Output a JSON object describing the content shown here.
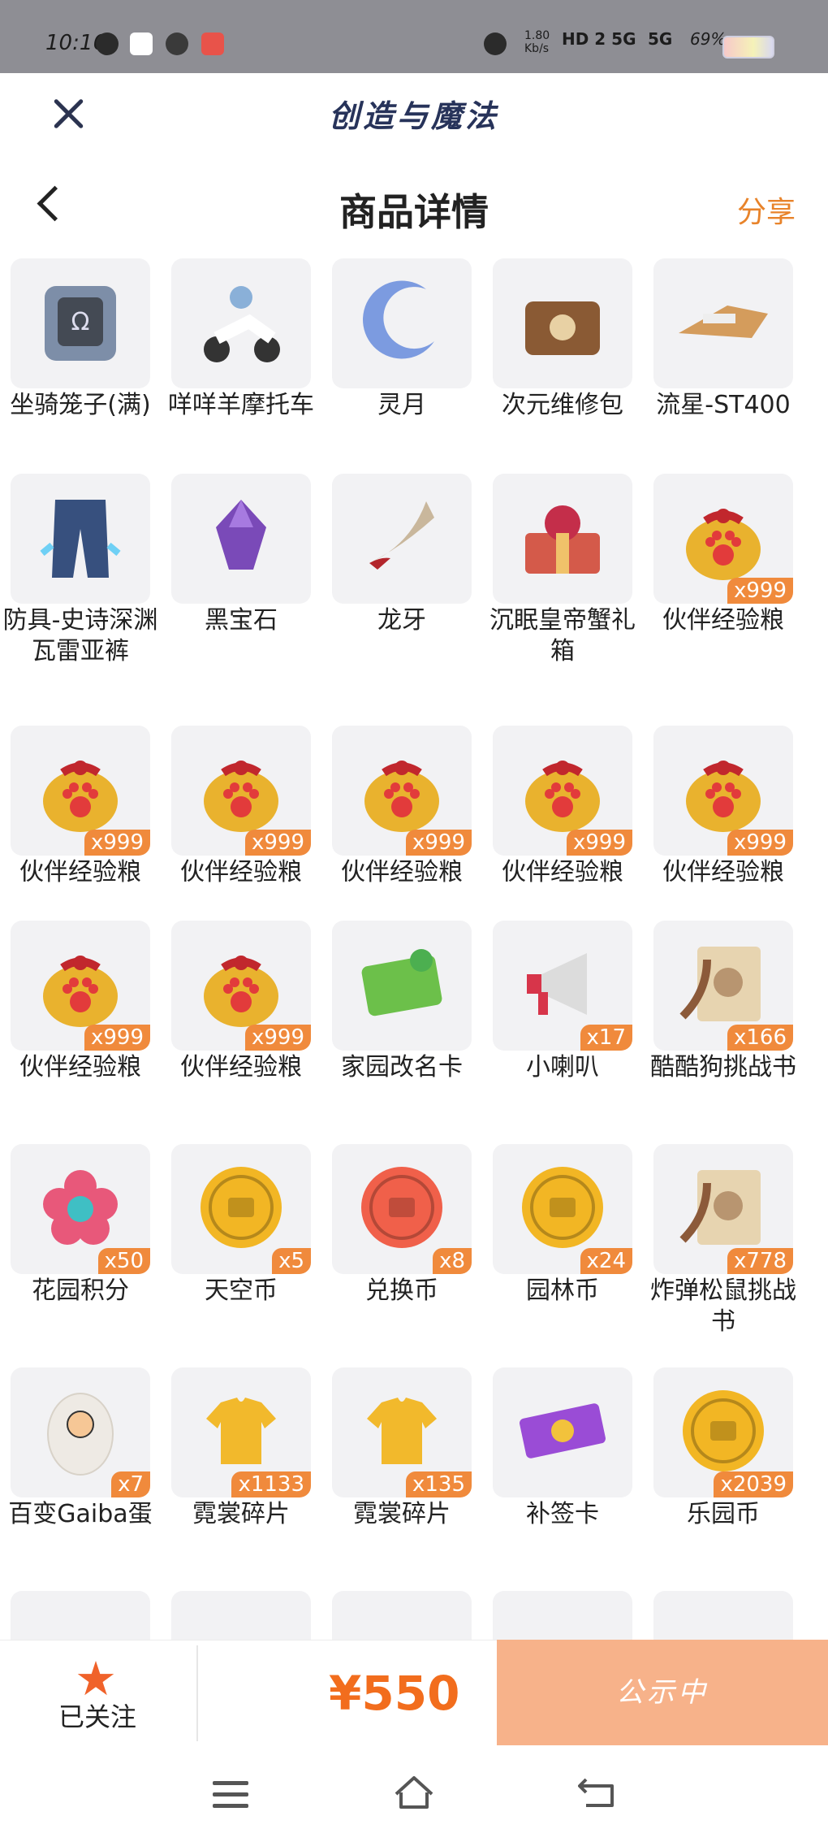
{
  "status_bar": {
    "time": "10:16",
    "network_speed": "1.80\nKb/s",
    "signal1": "HD 2 5G",
    "signal2": "5G",
    "battery": "69%"
  },
  "app_header": {
    "title": "创造与魔法"
  },
  "nav": {
    "title": "商品详情",
    "share_label": "分享"
  },
  "items": [
    {
      "label": "坐骑笼子(满)",
      "qty": "",
      "icon": "cage-icon",
      "color": "#7d8ea8"
    },
    {
      "label": "咩咩羊摩托车",
      "qty": "",
      "icon": "scooter-icon",
      "color": "#8ab0d8"
    },
    {
      "label": "灵月",
      "qty": "",
      "icon": "crescent-moon-icon",
      "color": "#7c9be0"
    },
    {
      "label": "次元维修包",
      "qty": "",
      "icon": "repair-bag-icon",
      "color": "#8a5a34"
    },
    {
      "label": "流星-ST400",
      "qty": "",
      "icon": "hoverbike-icon",
      "color": "#d49c5c"
    },
    {
      "label": "防具-史诗深渊瓦雷亚裤",
      "qty": "",
      "icon": "armor-pants-icon",
      "color": "#37507e"
    },
    {
      "label": "黑宝石",
      "qty": "",
      "icon": "black-gem-icon",
      "color": "#7a4ab8"
    },
    {
      "label": "龙牙",
      "qty": "",
      "icon": "dragon-tooth-icon",
      "color": "#c9b79c"
    },
    {
      "label": "沉眠皇帝蟹礼箱",
      "qty": "",
      "icon": "gift-chest-icon",
      "color": "#d45a4a"
    },
    {
      "label": "伙伴经验粮",
      "qty": "x999",
      "icon": "food-bag-icon",
      "color": "#e9b22e"
    },
    {
      "label": "伙伴经验粮",
      "qty": "x999",
      "icon": "food-bag-icon",
      "color": "#e9b22e"
    },
    {
      "label": "伙伴经验粮",
      "qty": "x999",
      "icon": "food-bag-icon",
      "color": "#e9b22e"
    },
    {
      "label": "伙伴经验粮",
      "qty": "x999",
      "icon": "food-bag-icon",
      "color": "#e9b22e"
    },
    {
      "label": "伙伴经验粮",
      "qty": "x999",
      "icon": "food-bag-icon",
      "color": "#e9b22e"
    },
    {
      "label": "伙伴经验粮",
      "qty": "x999",
      "icon": "food-bag-icon",
      "color": "#e9b22e"
    },
    {
      "label": "伙伴经验粮",
      "qty": "x999",
      "icon": "food-bag-icon",
      "color": "#e9b22e"
    },
    {
      "label": "伙伴经验粮",
      "qty": "x999",
      "icon": "food-bag-icon",
      "color": "#e9b22e"
    },
    {
      "label": "家园改名卡",
      "qty": "",
      "icon": "rename-card-icon",
      "color": "#6cc04a"
    },
    {
      "label": "小喇叭",
      "qty": "x17",
      "icon": "megaphone-icon",
      "color": "#d7354a"
    },
    {
      "label": "酷酷狗挑战书",
      "qty": "x166",
      "icon": "wanted-scroll-icon",
      "color": "#b89570"
    },
    {
      "label": "花园积分",
      "qty": "x50",
      "icon": "flower-token-icon",
      "color": "#e8587a"
    },
    {
      "label": "天空币",
      "qty": "x5",
      "icon": "sky-coin-icon",
      "color": "#f2b624"
    },
    {
      "label": "兑换币",
      "qty": "x8",
      "icon": "exchange-coin-icon",
      "color": "#f0604a"
    },
    {
      "label": "园林币",
      "qty": "x24",
      "icon": "garden-coin-icon",
      "color": "#f2b624"
    },
    {
      "label": "炸弹松鼠挑战书",
      "qty": "x778",
      "icon": "wanted-scroll-icon",
      "color": "#b89570"
    },
    {
      "label": "百变Gaiba蛋",
      "qty": "x7",
      "icon": "egg-icon",
      "color": "#eeeae4"
    },
    {
      "label": "霓裳碎片",
      "qty": "x1133",
      "icon": "shirt-icon",
      "color": "#f2b92c"
    },
    {
      "label": "霓裳碎片",
      "qty": "x135",
      "icon": "shirt-icon",
      "color": "#f2b92c"
    },
    {
      "label": "补签卡",
      "qty": "",
      "icon": "ticket-icon",
      "color": "#9a4cd6"
    },
    {
      "label": "乐园币",
      "qty": "x2039",
      "icon": "park-coin-icon",
      "color": "#f2b624"
    }
  ],
  "action_bar": {
    "follow_label": "已关注",
    "price": "¥550",
    "buy_label": "公示中"
  }
}
